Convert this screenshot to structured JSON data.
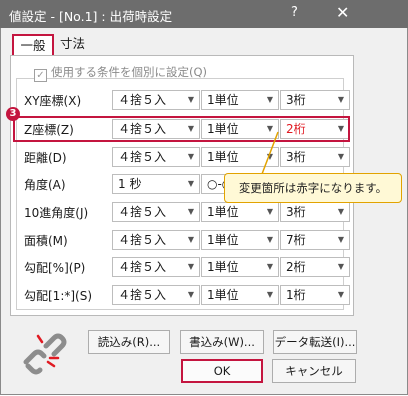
{
  "window": {
    "title": "値設定 - [No.1] : 出荷時設定",
    "help_label": "?",
    "close_label": "✕"
  },
  "tabs": [
    {
      "label": "一般"
    },
    {
      "label": "寸法"
    }
  ],
  "individual_checkbox": {
    "label": "使用する条件を個別に設定(Q)",
    "checked": true,
    "check_glyph": "✓"
  },
  "rows": [
    {
      "label": "XY座標(X)",
      "rounding": "４捨５入",
      "unit": "1単位",
      "digits": "3桁"
    },
    {
      "label": "Z座標(Z)",
      "rounding": "４捨５入",
      "unit": "1単位",
      "digits": "2桁"
    },
    {
      "label": "距離(D)",
      "rounding": "４捨５入",
      "unit": "1単位",
      "digits": "3桁"
    },
    {
      "label": "角度(A)",
      "rounding": "1 秒",
      "unit": "○-○-○",
      "digits": ""
    },
    {
      "label": "10進角度(J)",
      "rounding": "４捨５入",
      "unit": "1単位",
      "digits": "3桁"
    },
    {
      "label": "面積(M)",
      "rounding": "４捨５入",
      "unit": "1単位",
      "digits": "7桁"
    },
    {
      "label": "勾配[%](P)",
      "rounding": "４捨５入",
      "unit": "1単位",
      "digits": "2桁"
    },
    {
      "label": "勾配[1:*](S)",
      "rounding": "４捨５入",
      "unit": "1単位",
      "digits": "1桁"
    }
  ],
  "annotation": {
    "step": "3",
    "callout": "変更箇所は赤字になります。"
  },
  "colors": {
    "highlight": "#c4153f",
    "changed_text": "#e01a22",
    "callout_border": "#e2a300"
  },
  "buttons": {
    "load": "読込み(R)...",
    "save": "書込み(W)...",
    "transfer": "データ転送(I)...",
    "ok": "OK",
    "cancel": "キャンセル"
  }
}
